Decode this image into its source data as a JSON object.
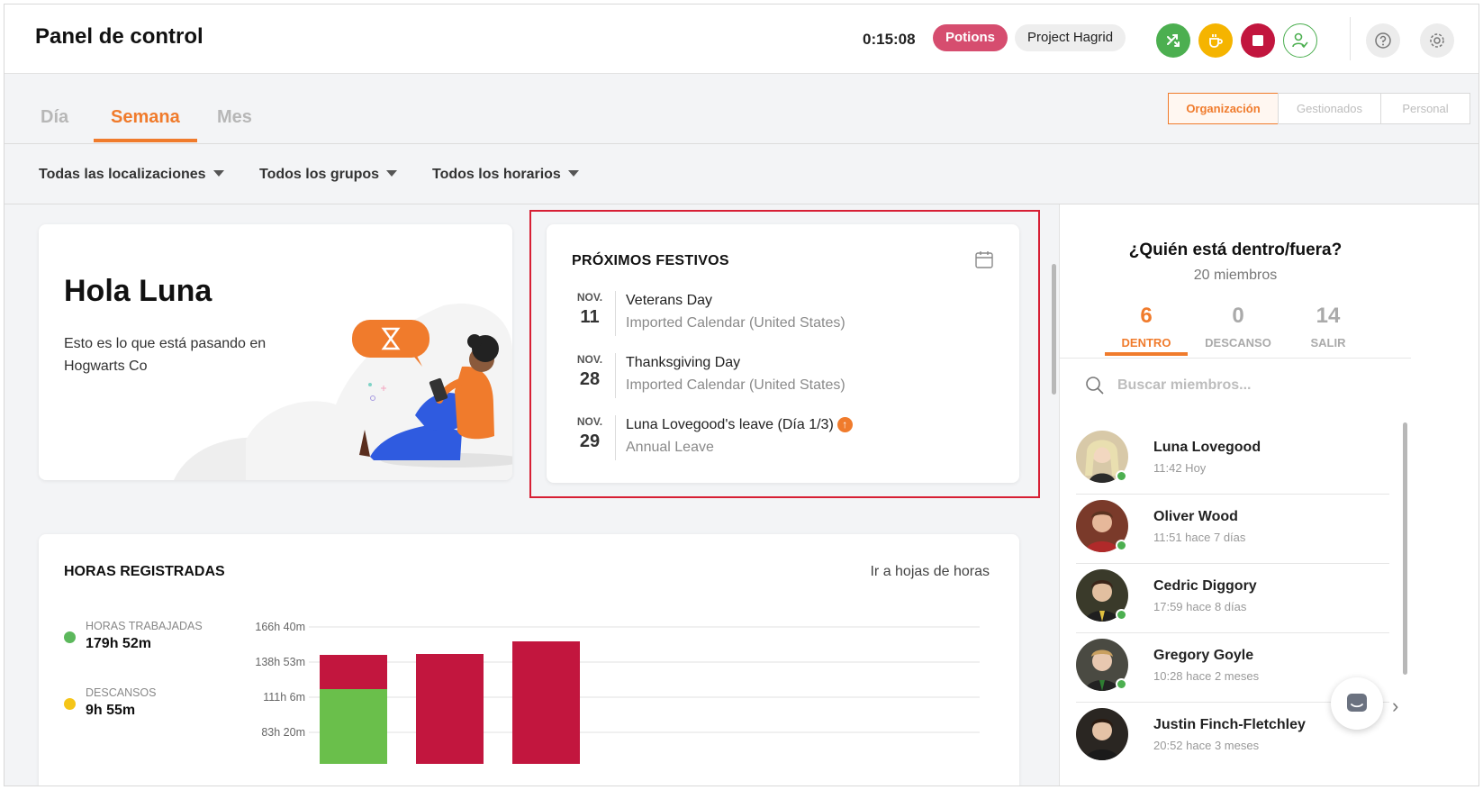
{
  "header": {
    "title": "Panel de control",
    "timer": "0:15:08",
    "activity": "Potions",
    "project": "Project Hagrid"
  },
  "colors": {
    "accent": "#f07b2c",
    "green": "#4caf50",
    "yellow": "#f5b400",
    "red": "#c2163e",
    "potions": "#d64d6f"
  },
  "tabs": {
    "dia": "Día",
    "semana": "Semana",
    "mes": "Mes",
    "active": "Semana"
  },
  "scope": {
    "org": "Organización",
    "gestionados": "Gestionados",
    "personal": "Personal"
  },
  "filters": {
    "locations": "Todas las localizaciones",
    "groups": "Todos los grupos",
    "schedules": "Todos los horarios"
  },
  "hello": {
    "title": "Hola Luna",
    "text": "Esto es lo que está pasando en Hogwarts Co"
  },
  "holidays": {
    "title": "PRÓXIMOS FESTIVOS",
    "items": [
      {
        "month": "NOV.",
        "day": "11",
        "name": "Veterans Day",
        "sub": "Imported Calendar (United States)"
      },
      {
        "month": "NOV.",
        "day": "28",
        "name": "Thanksgiving Day",
        "sub": "Imported Calendar (United States)"
      },
      {
        "month": "NOV.",
        "day": "29",
        "name": "Luna Lovegood's leave (Día 1/3)",
        "sub": "Annual Leave"
      }
    ]
  },
  "hours": {
    "title": "HORAS REGISTRADAS",
    "link": "Ir a hojas de horas",
    "legend": [
      {
        "label": "HORAS TRABAJADAS",
        "value": "179h 52m",
        "color": "#5cb85c"
      },
      {
        "label": "DESCANSOS",
        "value": "9h 55m",
        "color": "#f5c518"
      }
    ]
  },
  "chart_data": {
    "type": "bar",
    "y_ticks": [
      "166h 40m",
      "138h 53m",
      "111h 6m",
      "83h 20m"
    ],
    "series": [
      {
        "values": [
          83,
          0,
          0
        ],
        "color": "#6abf4b"
      },
      {
        "values": [
          38,
          122,
          136
        ],
        "color": "#c2163e"
      }
    ]
  },
  "sidebar": {
    "title": "¿Quién está dentro/fuera?",
    "members": "20 miembros",
    "stats": [
      {
        "value": "6",
        "label": "DENTRO"
      },
      {
        "value": "0",
        "label": "DESCANSO"
      },
      {
        "value": "14",
        "label": "SALIR"
      }
    ],
    "search_placeholder": "Buscar miembros...",
    "people": [
      {
        "name": "Luna Lovegood",
        "time": "11:42 Hoy"
      },
      {
        "name": "Oliver Wood",
        "time": "11:51 hace 7 días"
      },
      {
        "name": "Cedric Diggory",
        "time": "17:59 hace 8 días"
      },
      {
        "name": "Gregory Goyle",
        "time": "10:28 hace 2 meses"
      },
      {
        "name": "Justin Finch-Fletchley",
        "time": "20:52 hace 3 meses"
      }
    ]
  }
}
